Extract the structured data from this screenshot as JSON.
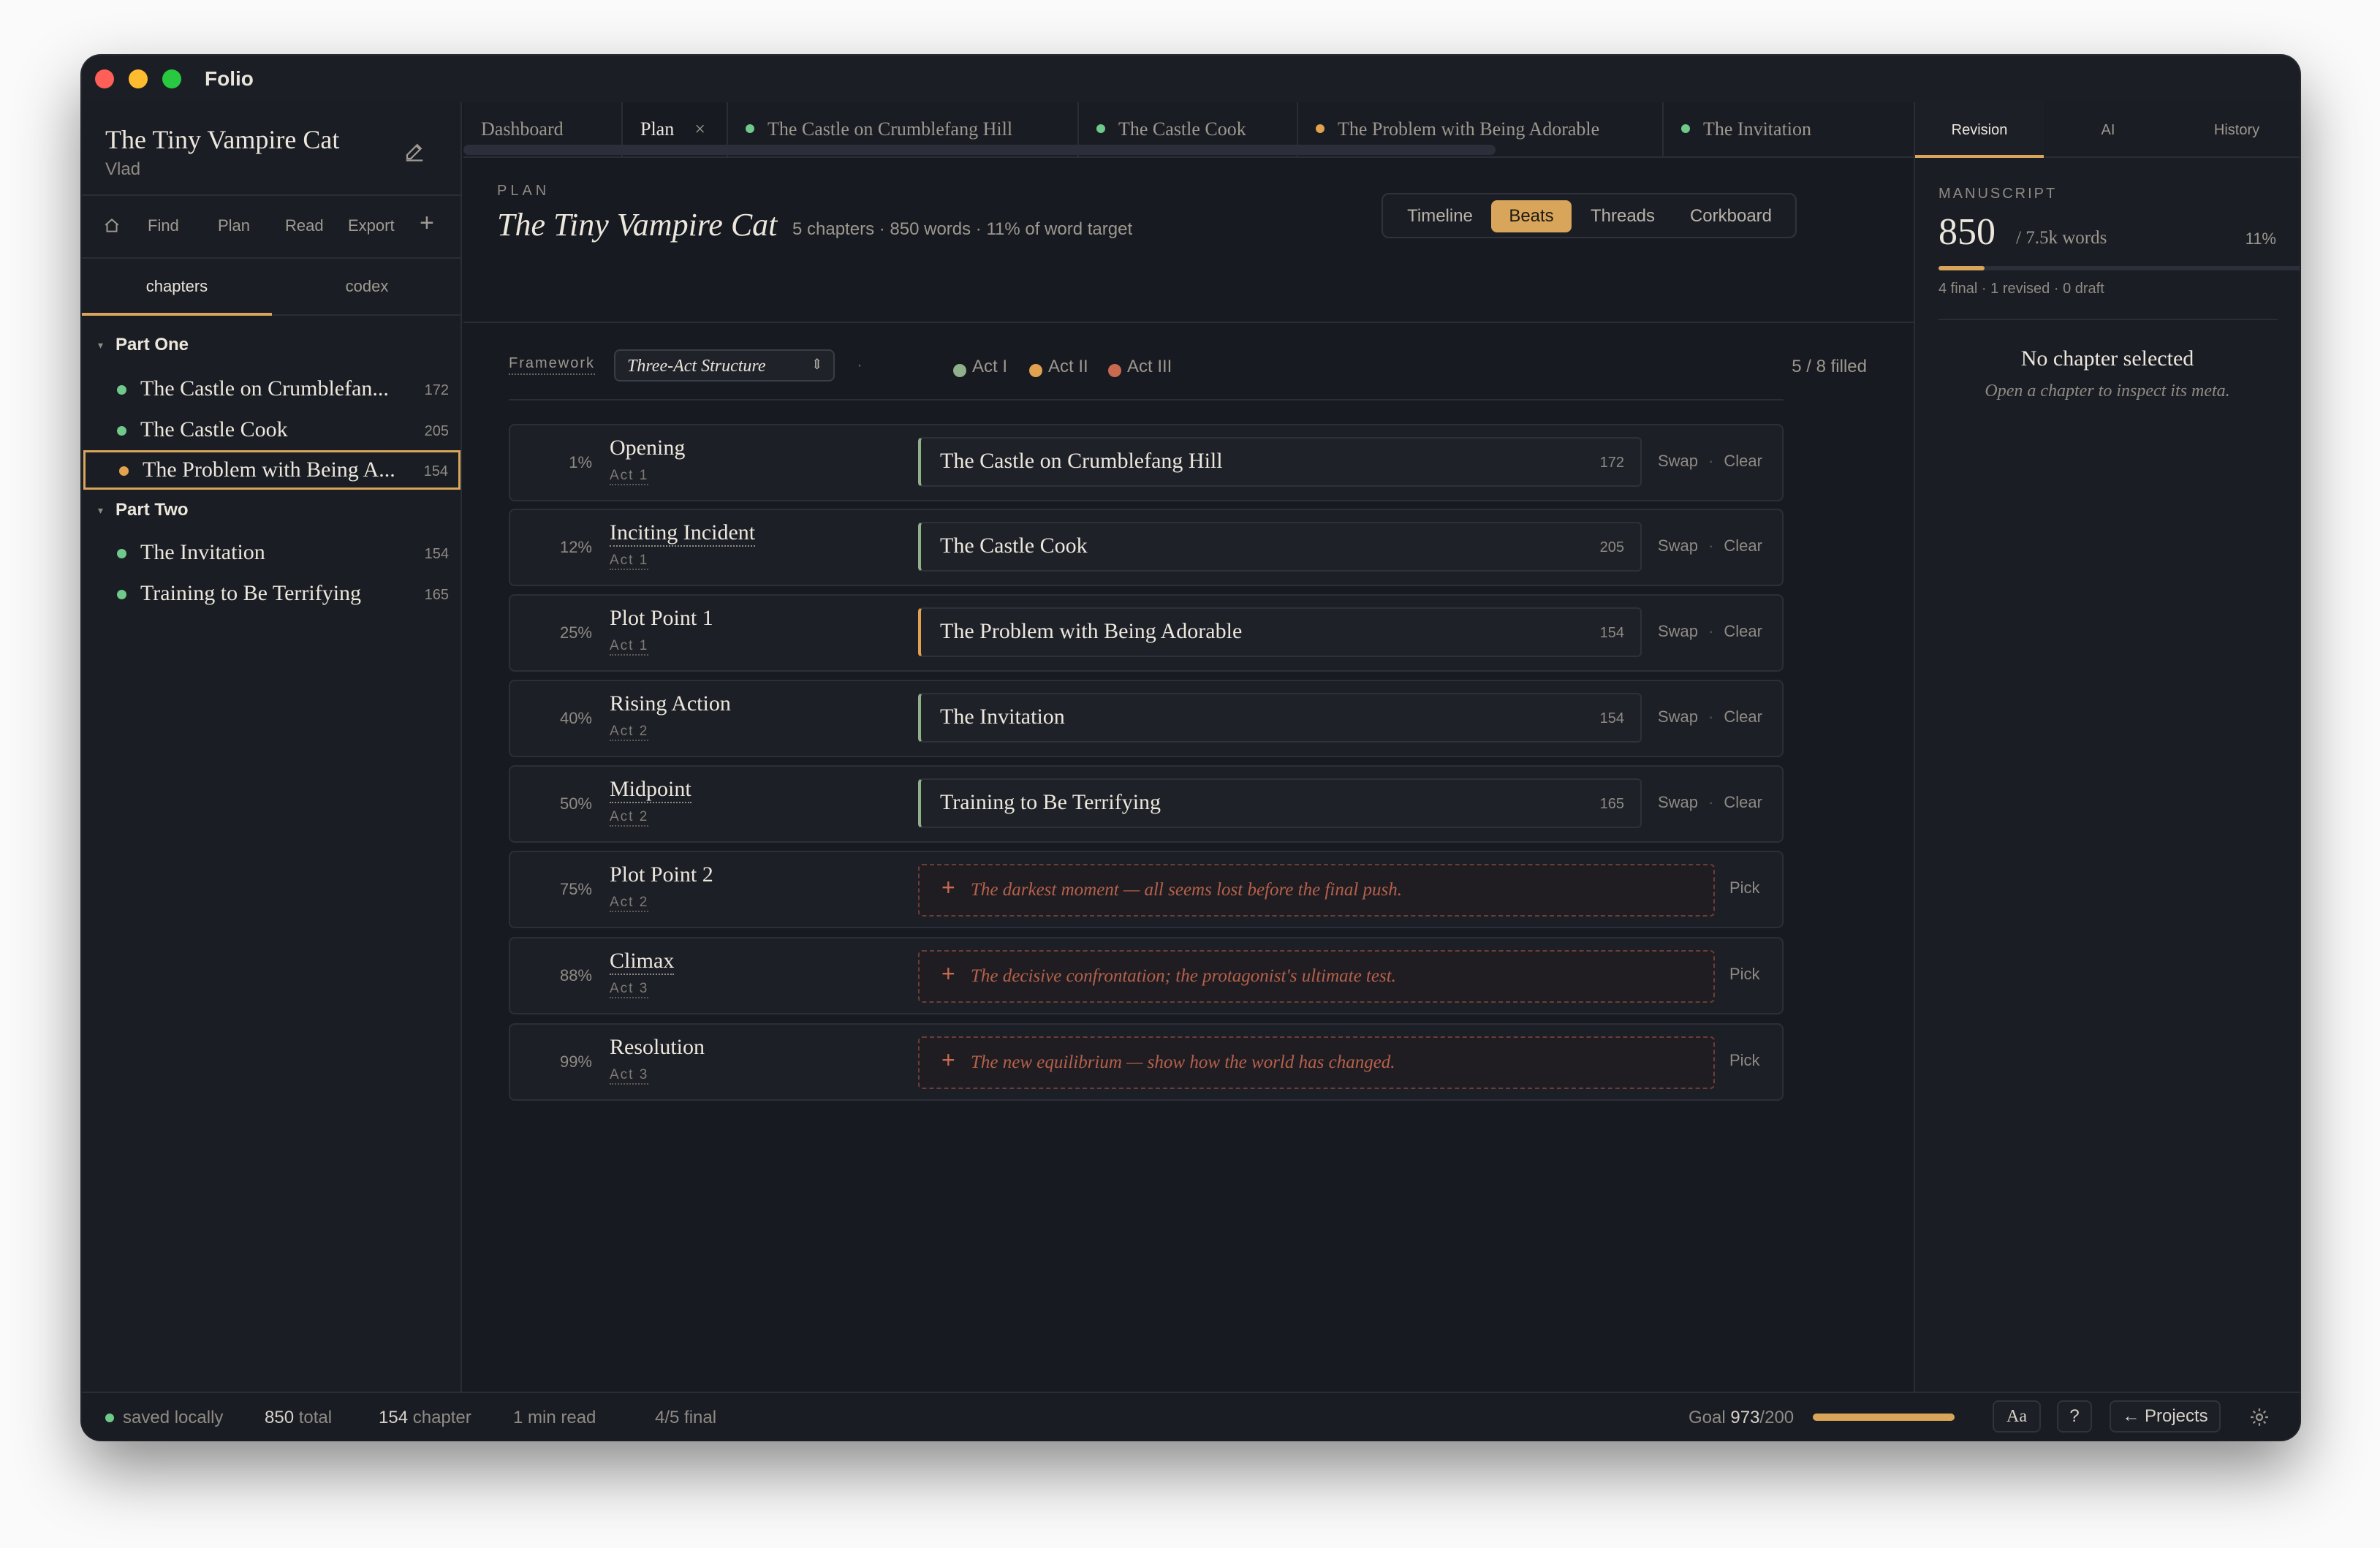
{
  "app": {
    "name": "Folio"
  },
  "colors": {
    "accent": "#d8a55a",
    "final": "#6ec98a",
    "revised": "#e2a24e",
    "empty_border": "#6a3e37",
    "act1": "#8fb08a",
    "act2": "#e0a24e",
    "act3": "#c9694f"
  },
  "sidebar": {
    "project_title": "The Tiny Vampire Cat",
    "author": "Vlad",
    "tools": [
      {
        "label": "Find"
      },
      {
        "label": "Plan"
      },
      {
        "label": "Read"
      },
      {
        "label": "Export"
      }
    ],
    "tabs": [
      "chapters",
      "codex"
    ],
    "parts": [
      {
        "label": "Part One",
        "chapters": [
          {
            "title": "The Castle on Crumblefan...",
            "words": "172",
            "status": "final"
          },
          {
            "title": "The Castle Cook",
            "words": "205",
            "status": "final"
          },
          {
            "title": "The Problem with Being A...",
            "words": "154",
            "status": "revised",
            "selected": true
          }
        ]
      },
      {
        "label": "Part Two",
        "chapters": [
          {
            "title": "The Invitation",
            "words": "154",
            "status": "final"
          },
          {
            "title": "Training to Be Terrifying",
            "words": "165",
            "status": "final"
          }
        ]
      }
    ]
  },
  "tabs": [
    {
      "label": "Dashboard"
    },
    {
      "label": "Plan",
      "active": true
    },
    {
      "label": "The Castle on Crumblefang Hill",
      "status": "final"
    },
    {
      "label": "The Castle Cook",
      "status": "final"
    },
    {
      "label": "The Problem with Being Adorable",
      "status": "revised"
    },
    {
      "label": "The Invitation",
      "status": "final"
    }
  ],
  "plan": {
    "kicker": "PLAN",
    "title": "The Tiny Vampire Cat",
    "subtitle": "5 chapters · 850 words · 11% of word target",
    "views": [
      "Timeline",
      "Beats",
      "Threads",
      "Corkboard"
    ],
    "active_view": "Beats",
    "framework_label": "Framework",
    "framework": "Three-Act Structure",
    "acts": [
      "Act I",
      "Act II",
      "Act III"
    ],
    "filled": "5 / 8 filled",
    "beats": [
      {
        "pct": "1%",
        "name": "Opening",
        "act": "Act 1",
        "chapter": "The Castle on Crumblefang Hill",
        "words": "172",
        "actcolor": "act1"
      },
      {
        "pct": "12%",
        "name": "Inciting Incident",
        "act": "Act 1",
        "chapter": "The Castle Cook",
        "words": "205",
        "actcolor": "act1"
      },
      {
        "pct": "25%",
        "name": "Plot Point 1",
        "act": "Act 1",
        "chapter": "The Problem with Being Adorable",
        "words": "154",
        "actcolor": "act2"
      },
      {
        "pct": "40%",
        "name": "Rising Action",
        "act": "Act 2",
        "chapter": "The Invitation",
        "words": "154",
        "actcolor": "act1"
      },
      {
        "pct": "50%",
        "name": "Midpoint",
        "act": "Act 2",
        "chapter": "Training to Be Terrifying",
        "words": "165",
        "actcolor": "act1"
      },
      {
        "pct": "75%",
        "name": "Plot Point 2",
        "act": "Act 2",
        "hint": "The darkest moment — all seems lost before the final push."
      },
      {
        "pct": "88%",
        "name": "Climax",
        "act": "Act 3",
        "hint": "The decisive confrontation; the protagonist's ultimate test."
      },
      {
        "pct": "99%",
        "name": "Resolution",
        "act": "Act 3",
        "hint": "The new equilibrium — show how the world has changed."
      }
    ],
    "swap_label": "Swap",
    "clear_label": "Clear",
    "pick_label": "Pick"
  },
  "right_panel": {
    "tabs": [
      "Revision",
      "AI",
      "History"
    ],
    "kicker": "MANUSCRIPT",
    "words": "850",
    "of": "/ 7.5k words",
    "pct": "11%",
    "progress": 0.11,
    "meta": "4 final · 1 revised · 0 draft",
    "empty_title": "No chapter selected",
    "empty_hint": "Open a chapter to inspect its meta."
  },
  "status": {
    "saved": "saved locally",
    "total_num": "850",
    "total_lbl": "total",
    "chapter_num": "154",
    "chapter_lbl": "chapter",
    "read": "1 min read",
    "final": "4/5 final",
    "goal_lbl": "Goal",
    "goal_val": "973",
    "goal_target": "/200",
    "goal_progress": 1.0,
    "font_btn": "Aa",
    "help_btn": "?",
    "projects_btn": "← Projects"
  }
}
